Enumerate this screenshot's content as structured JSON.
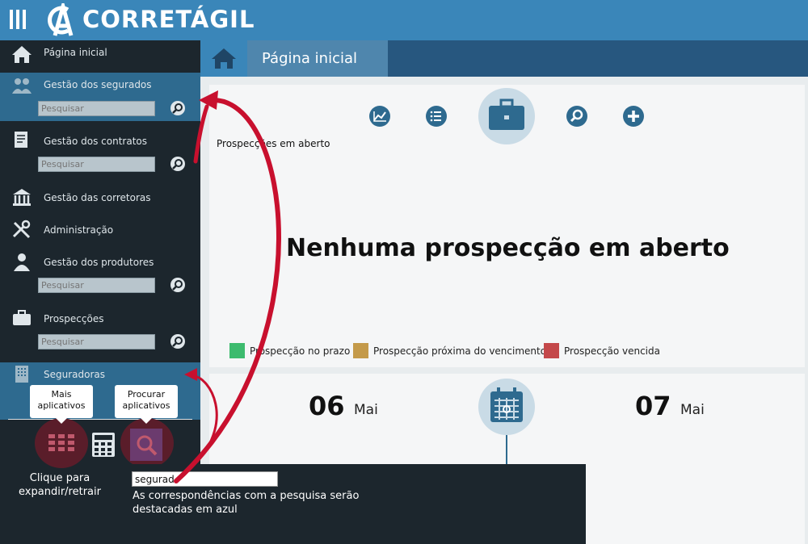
{
  "app": {
    "brand": "CORRETÁGIL",
    "logo_letters": "CA"
  },
  "sidebar": {
    "items": [
      {
        "label": "Página inicial",
        "icon": "home-icon"
      },
      {
        "label": "Gestão dos segurados",
        "icon": "users-icon",
        "search_placeholder": "Pesquisar"
      },
      {
        "label": "Gestão dos contratos",
        "icon": "contract-icon",
        "search_placeholder": "Pesquisar"
      },
      {
        "label": "Gestão das corretoras",
        "icon": "bank-icon"
      },
      {
        "label": "Administração",
        "icon": "tools-icon"
      },
      {
        "label": "Gestão dos produtores",
        "icon": "producer-icon",
        "search_placeholder": "Pesquisar"
      },
      {
        "label": "Prospecções",
        "icon": "briefcase-icon",
        "search_placeholder": "Pesquisar"
      },
      {
        "label": "Seguradoras",
        "icon": "building-icon"
      }
    ]
  },
  "header": {
    "title": "Página inicial"
  },
  "main": {
    "tools_label": "Prospecções em aberto",
    "empty_message": "Nenhuma prospecção em aberto",
    "legend": [
      {
        "label": "Prospecção no prazo",
        "color": "#3dbb6e"
      },
      {
        "label": "Prospecção próxima do vencimento",
        "color": "#c49a4a"
      },
      {
        "label": "Prospecção vencida",
        "color": "#c4484a"
      }
    ],
    "dates": [
      {
        "day": "06",
        "month": "Mai"
      },
      {
        "day": "07",
        "month": "Mai"
      }
    ]
  },
  "overlays": {
    "tooltip_more_apps": "Mais aplicativos",
    "tooltip_search_apps": "Procurar aplicativos",
    "click_caption": "Clique para expandir/retrair",
    "search_value": "segurad",
    "search_caption": "As correspondências com a pesquisa serão destacadas em azul"
  },
  "colors": {
    "topbar": "#3a86b9",
    "sidebar": "#1c262d",
    "accent": "#2e6a8f",
    "arrow": "#c8102e"
  }
}
